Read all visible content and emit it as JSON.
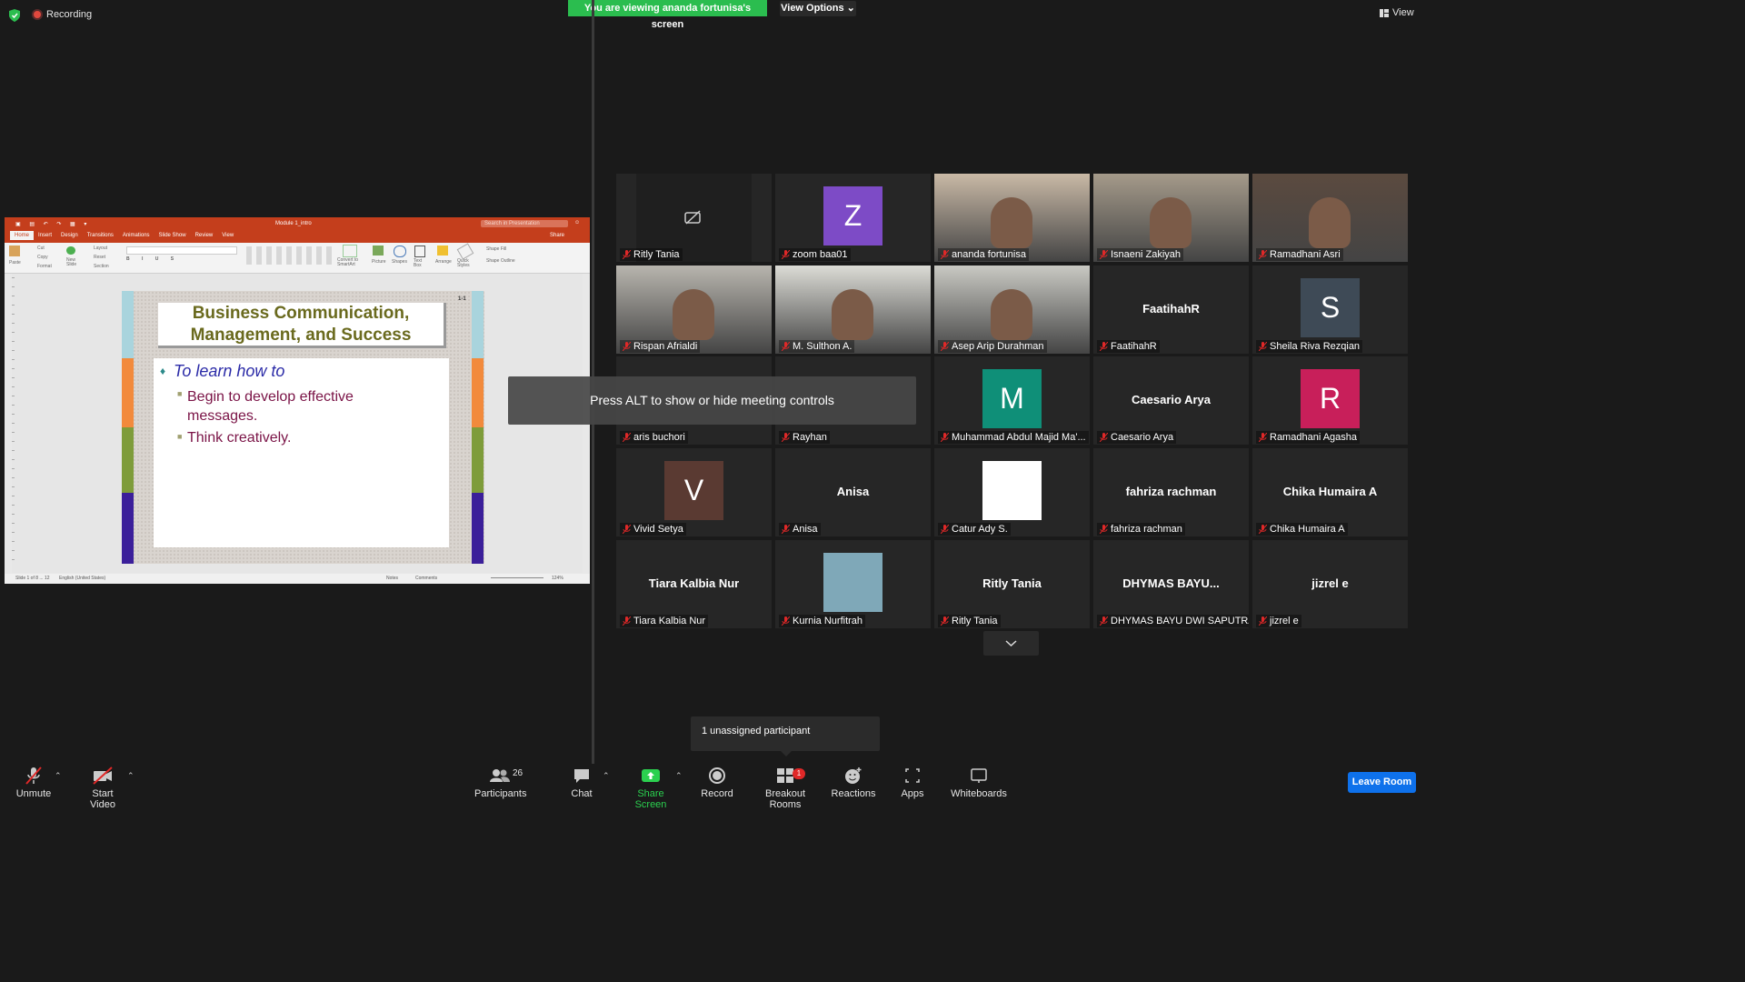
{
  "top": {
    "recording_label": "Recording",
    "viewing_banner": "You are viewing ananda fortunisa's screen",
    "view_options": "View Options ⌄",
    "view_label": "View"
  },
  "ppt": {
    "filename": "Module 1_intro",
    "search_placeholder": "Search in Presentation",
    "share": "Share",
    "tabs": [
      "Home",
      "Insert",
      "Design",
      "Transitions",
      "Animations",
      "Slide Show",
      "Review",
      "View"
    ],
    "ribbon_labels": {
      "paste": "Paste",
      "cut": "Cut",
      "copy": "Copy",
      "format": "Format",
      "new_slide": "New Slide",
      "layout": "Layout",
      "reset": "Reset",
      "section": "Section",
      "convert": "Convert to SmartArt",
      "picture": "Picture",
      "shapes": "Shapes",
      "text_box": "Text Box",
      "arrange": "Arrange",
      "quick_styles": "Quick Styles",
      "shape_fill": "Shape Fill",
      "shape_outline": "Shape Outline"
    },
    "status_left": "Slide 1 of 8 ... 12",
    "status_lang": "English (United States)",
    "notes": "Notes",
    "comments": "Comments",
    "zoom": "124%",
    "slide_number": "1-1",
    "slide_title": "Business Communication, Management, and Success",
    "bullets": [
      "To learn how to",
      "Begin to develop effective messages.",
      "Think creatively."
    ],
    "strip_colors": [
      "#a9d4dd",
      "#f28a3c",
      "#7e9c3a",
      "#3b1f9a"
    ]
  },
  "grid": [
    {
      "name": "Ritly Tania",
      "kind": "video-off"
    },
    {
      "name": "zoom baa01",
      "kind": "avatar",
      "letter": "Z",
      "color": "#7d4bc6"
    },
    {
      "name": "ananda fortunisa",
      "kind": "video",
      "bg": "#c9b9a6",
      "highlight": true
    },
    {
      "name": "Isnaeni Zakiyah",
      "kind": "video",
      "bg": "#a59a8a"
    },
    {
      "name": "Ramadhani Asri",
      "kind": "video",
      "bg": "#5b4a3f"
    },
    {
      "name": "Rispan Afrialdi",
      "kind": "video",
      "bg": "#b8b5ae"
    },
    {
      "name": "M. Sulthon A.",
      "kind": "video",
      "bg": "#dcdcd6"
    },
    {
      "name": "Asep Arip Durahman",
      "kind": "video",
      "bg": "#c9c9c3"
    },
    {
      "name": "FaatihahR",
      "kind": "text",
      "center": "FaatihahR"
    },
    {
      "name": "Sheila Riva Rezqian",
      "kind": "avatar",
      "letter": "S",
      "color": "#3e4a56"
    },
    {
      "name": "aris buchori",
      "kind": "text",
      "center": ""
    },
    {
      "name": "Rayhan",
      "kind": "text",
      "center": ""
    },
    {
      "name": "Muhammad Abdul Majid Ma'...",
      "kind": "avatar",
      "letter": "M",
      "color": "#0f8f78"
    },
    {
      "name": "Caesario Arya",
      "kind": "text",
      "center": "Caesario Arya"
    },
    {
      "name": "Ramadhani Agasha",
      "kind": "avatar",
      "letter": "R",
      "color": "#c81f5a"
    },
    {
      "name": "Vivid Setya",
      "kind": "avatar",
      "letter": "V",
      "color": "#5a3a32"
    },
    {
      "name": "Anisa",
      "kind": "text",
      "center": "Anisa"
    },
    {
      "name": "Catur Ady S.",
      "kind": "image",
      "bg": "#ffffff"
    },
    {
      "name": "fahriza rachman",
      "kind": "text",
      "center": "fahriza rachman"
    },
    {
      "name": "Chika Humaira A",
      "kind": "text",
      "center": "Chika Humaira A"
    },
    {
      "name": "Tiara Kalbia Nur",
      "kind": "text",
      "center": "Tiara Kalbia Nur"
    },
    {
      "name": "Kurnia Nurfitrah",
      "kind": "image",
      "bg": "#7fa8b8"
    },
    {
      "name": "Ritly Tania",
      "kind": "text",
      "center": "Ritly Tania"
    },
    {
      "name": "DHYMAS BAYU DWI SAPUTRA",
      "kind": "text",
      "center": "DHYMAS  BAYU..."
    },
    {
      "name": "jizrel e",
      "kind": "text",
      "center": "jizrel e"
    }
  ],
  "overlay_text": "Press ALT to show or hide meeting controls",
  "unassigned": "1 unassigned participant",
  "toolbar": {
    "unmute": "Unmute",
    "start_video": "Start Video",
    "participants": "Participants",
    "participants_count": "26",
    "chat": "Chat",
    "share_screen": "Share Screen",
    "record": "Record",
    "breakout": "Breakout Rooms",
    "breakout_badge": "1",
    "reactions": "Reactions",
    "apps": "Apps",
    "whiteboards": "Whiteboards",
    "leave": "Leave Room"
  },
  "colors": {
    "banner_green": "#2bbd4f",
    "ppt_red": "#c43e1c",
    "leave_blue": "#0e71eb",
    "highlight": "#e1e85a"
  }
}
